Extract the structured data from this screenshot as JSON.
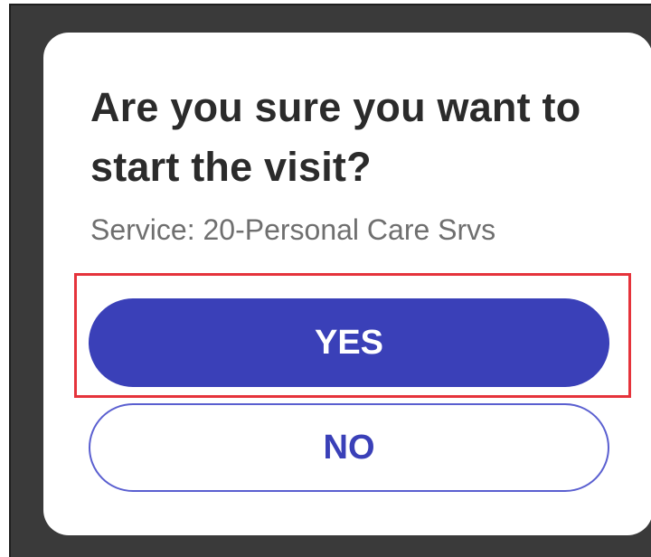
{
  "dialog": {
    "title": "Are you sure you want to start the visit?",
    "subtitle": "Service: 20-Personal Care Srvs",
    "yes_label": "YES",
    "no_label": "NO"
  },
  "colors": {
    "backdrop": "#3a3a3a",
    "primary": "#3a40b8",
    "outline": "#5a5fd0",
    "highlight": "#e5333b",
    "title_text": "#2b2b2b",
    "subtitle_text": "#6f6f6f"
  },
  "highlighted_element": "yes-button"
}
